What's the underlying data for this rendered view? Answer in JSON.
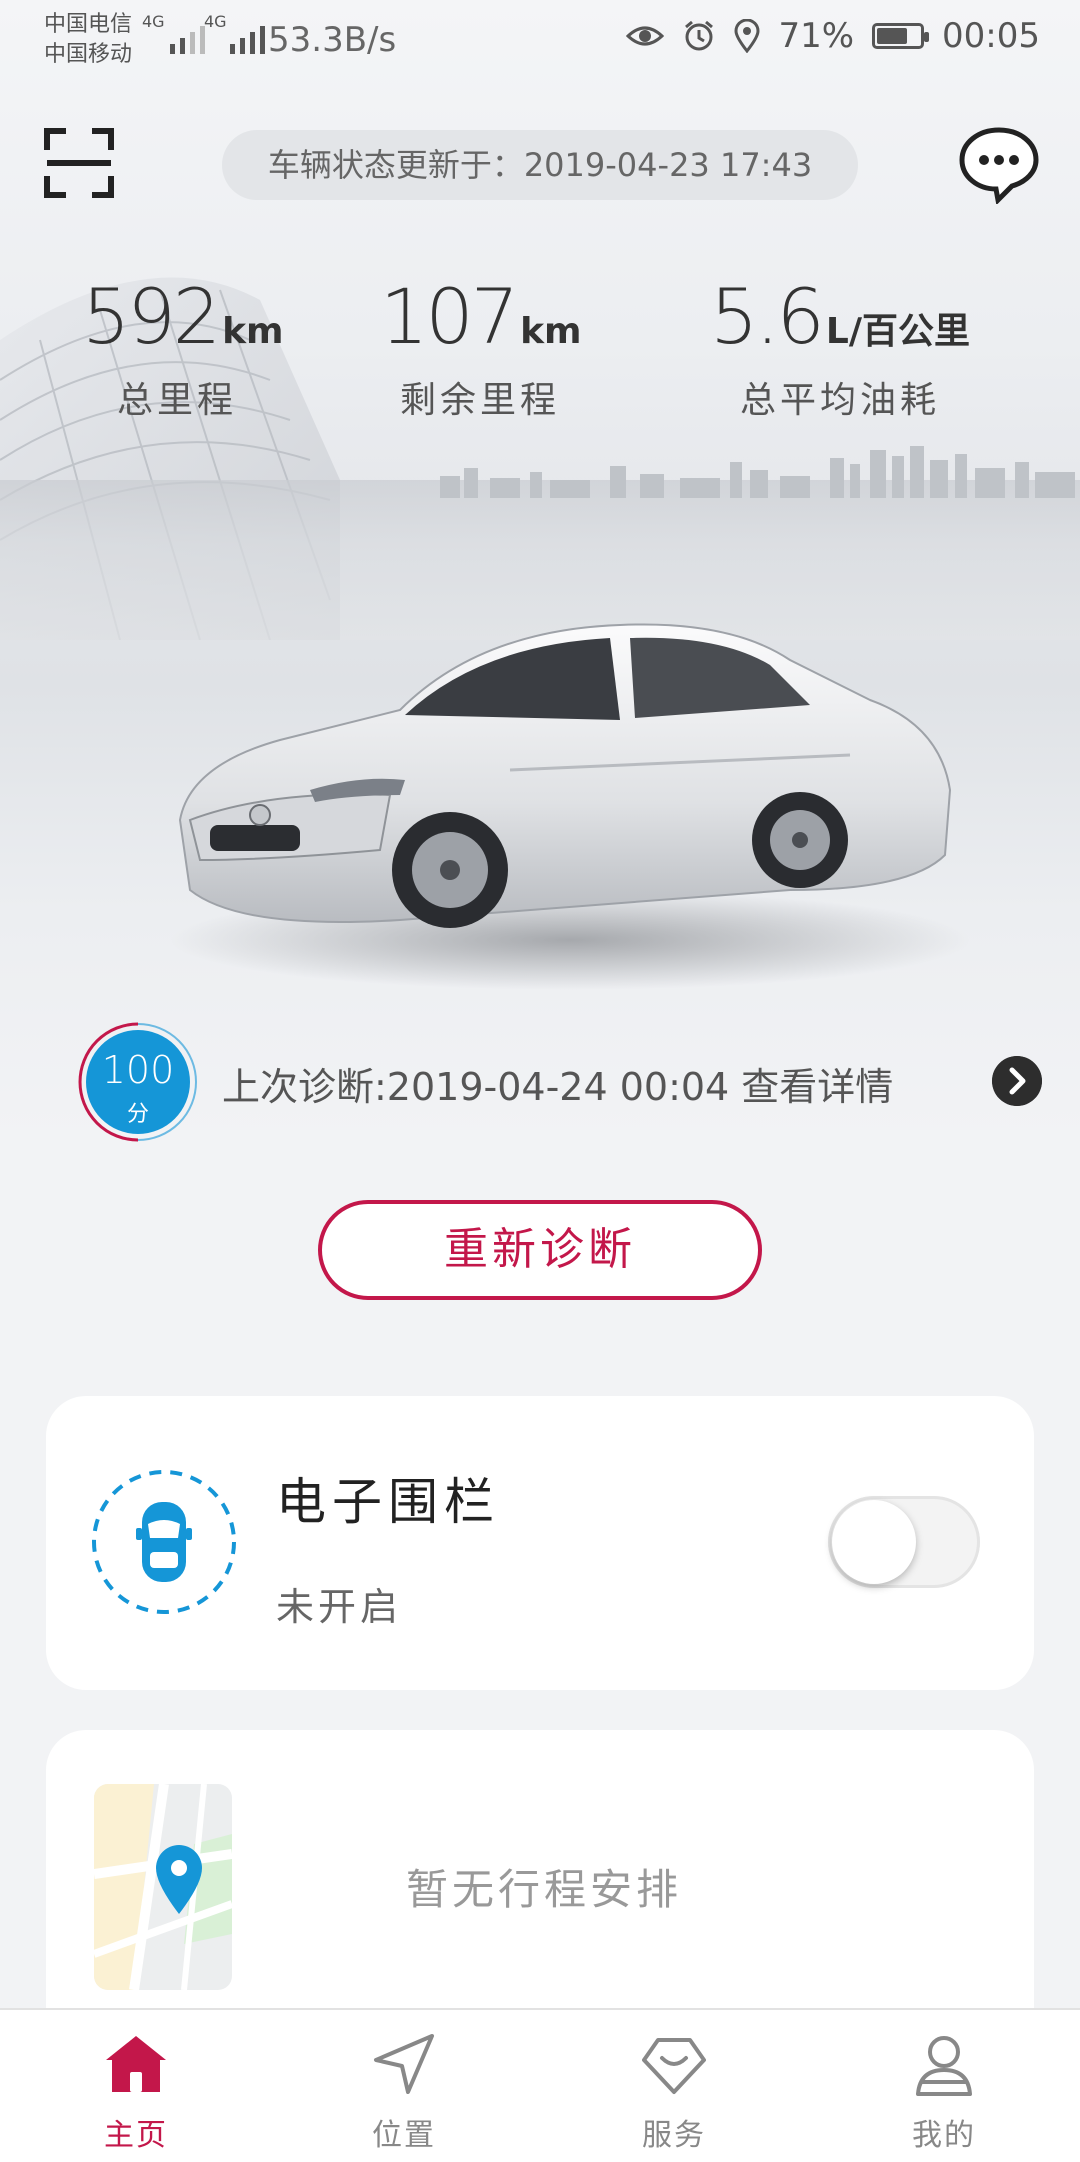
{
  "status_bar": {
    "carrier1": "中国电信",
    "carrier2": "中国移动",
    "net1": "4G",
    "net2": "4G",
    "speed": "53.3B/s",
    "battery_pct": "71%",
    "battery_level": 0.71,
    "time": "00:05",
    "icons": [
      "eye-icon",
      "alarm-icon",
      "location-icon",
      "battery-icon"
    ]
  },
  "header": {
    "update_text": "车辆状态更新于：2019-04-23 17:43",
    "scan_icon": "scan-icon",
    "message_icon": "chat-icon"
  },
  "stats": [
    {
      "value": "592",
      "unit": "km",
      "label": "总里程"
    },
    {
      "value": "107",
      "unit": "km",
      "label": "剩余里程"
    },
    {
      "value": "5.6",
      "unit": "L/百公里",
      "label": "总平均油耗"
    }
  ],
  "diagnosis": {
    "score": "100",
    "score_unit": "分",
    "text": "上次诊断:2019-04-24 00:04 查看详情",
    "button": "重新诊断"
  },
  "fence": {
    "title": "电子围栏",
    "status": "未开启",
    "enabled": false
  },
  "trip": {
    "empty_text": "暂无行程安排"
  },
  "tabs": [
    {
      "label": "主页",
      "icon": "home-icon",
      "active": true
    },
    {
      "label": "位置",
      "icon": "navigate-icon",
      "active": false
    },
    {
      "label": "服务",
      "icon": "service-icon",
      "active": false
    },
    {
      "label": "我的",
      "icon": "profile-icon",
      "active": false
    }
  ],
  "colors": {
    "accent": "#c3174a",
    "score_blue": "#1596d7",
    "background": "#f2f3f5"
  }
}
